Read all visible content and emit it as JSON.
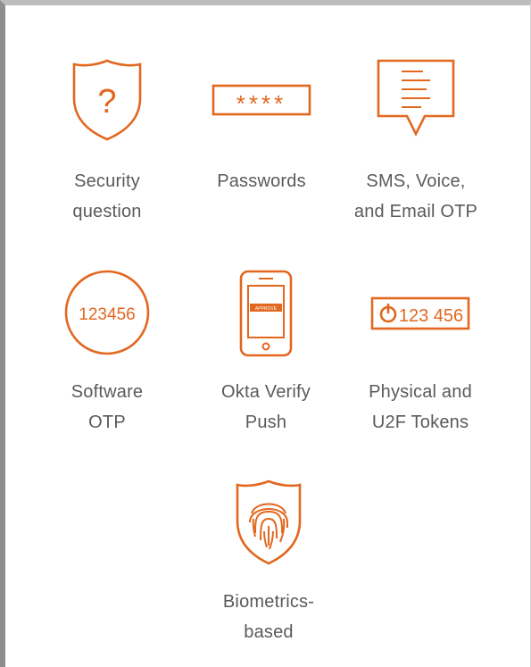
{
  "colors": {
    "accent": "#e2671f",
    "text": "#5a5a5a",
    "background": "#ffffff"
  },
  "items": [
    {
      "label": "Security\nquestion",
      "icon": "shield-question-icon",
      "glyph": "?"
    },
    {
      "label": "Passwords",
      "icon": "password-field-icon",
      "glyph": "****"
    },
    {
      "label": "SMS, Voice,\nand Email OTP",
      "icon": "message-bubble-icon"
    },
    {
      "label": "Software\nOTP",
      "icon": "software-otp-circle-icon",
      "glyph": "123456"
    },
    {
      "label": "Okta Verify\nPush",
      "icon": "phone-push-icon",
      "glyph": "APPROVE"
    },
    {
      "label": "Physical and\nU2F Tokens",
      "icon": "hardware-token-icon",
      "glyph": "123 456"
    },
    {
      "label": "Biometrics-\nbased",
      "icon": "fingerprint-shield-icon"
    }
  ]
}
